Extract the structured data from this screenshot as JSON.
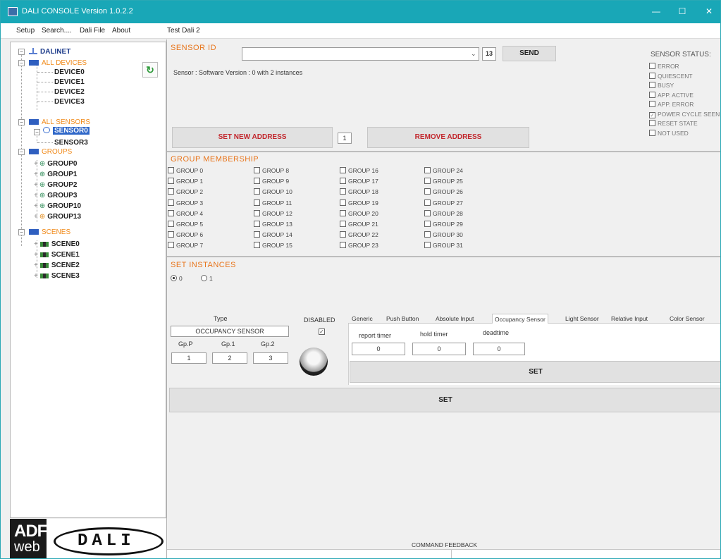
{
  "window": {
    "title": "DALI CONSOLE Version 1.0.2.2",
    "minimize": "—",
    "maximize": "☐",
    "close": "✕"
  },
  "menu": [
    "Setup",
    "Search....",
    "Dali File",
    "About",
    "Test Dali 2"
  ],
  "tree": {
    "root": "DALINET",
    "all_devices": "ALL DEVICES",
    "devices": [
      "DEVICE0",
      "DEVICE1",
      "DEVICE2",
      "DEVICE3"
    ],
    "all_sensors": "ALL SENSORS",
    "sensors": [
      "SENSOR0",
      "SENSOR3"
    ],
    "groups_label": "GROUPS",
    "groups": [
      "GROUP0",
      "GROUP1",
      "GROUP2",
      "GROUP3",
      "GROUP10",
      "GROUP13"
    ],
    "scenes_label": "SCENES",
    "scenes": [
      "SCENE0",
      "SCENE1",
      "SCENE2",
      "SCENE3"
    ],
    "refresh_icon": "refresh-icon"
  },
  "sensor_id": {
    "title": "SENSOR ID",
    "combo_value": "",
    "count": "13",
    "send": "SEND",
    "info": "Sensor :  Software Version : 0 with 2 instances"
  },
  "address": {
    "set_label": "SET NEW ADDRESS",
    "value": "1",
    "remove_label": "REMOVE  ADDRESS"
  },
  "sensor_status": {
    "title": "SENSOR STATUS:",
    "items": [
      {
        "label": "ERROR",
        "checked": false
      },
      {
        "label": "QUIESCENT",
        "checked": false
      },
      {
        "label": "BUSY",
        "checked": false
      },
      {
        "label": "APP. ACTIVE",
        "checked": false
      },
      {
        "label": "APP. ERROR",
        "checked": false
      },
      {
        "label": "POWER CYCLE SEEN",
        "checked": true
      },
      {
        "label": "RESET STATE",
        "checked": false
      },
      {
        "label": "NOT USED",
        "checked": false
      }
    ]
  },
  "group_membership": {
    "title": "GROUP MEMBERSHIP",
    "columns": [
      [
        "GROUP 0",
        "GROUP 1",
        "GROUP 2",
        "GROUP 3",
        "GROUP 4",
        "GROUP 5",
        "GROUP 6",
        "GROUP 7"
      ],
      [
        "GROUP 8",
        "GROUP 9",
        "GROUP 10",
        "GROUP 11",
        "GROUP 12",
        "GROUP 13",
        "GROUP 14",
        "GROUP 15"
      ],
      [
        "GROUP 16",
        "GROUP 17",
        "GROUP 18",
        "GROUP 19",
        "GROUP 20",
        "GROUP 21",
        "GROUP 22",
        "GROUP 23"
      ],
      [
        "GROUP 24",
        "GROUP 25",
        "GROUP 26",
        "GROUP 27",
        "GROUP 28",
        "GROUP 29",
        "GROUP 30",
        "GROUP 31"
      ]
    ]
  },
  "instances": {
    "title": "SET INSTANCES",
    "options": [
      "0",
      "1"
    ],
    "selected": "0"
  },
  "instance": {
    "type_label": "Type",
    "type_value": "OCCUPANCY SENSOR",
    "gp_labels": [
      "Gp.P",
      "Gp.1",
      "Gp.2"
    ],
    "gp_values": [
      "1",
      "2",
      "3"
    ],
    "disabled_label": "DISABLED",
    "disabled_checked": true,
    "tabs": [
      "Generic",
      "Push Button",
      "Absolute Input",
      "Occupancy Sensor",
      "Light Sensor",
      "Relative Input",
      "Color Sensor"
    ],
    "active_tab": "Occupancy Sensor",
    "fields": [
      {
        "label": "report timer",
        "value": "0"
      },
      {
        "label": "hold timer",
        "value": "0"
      },
      {
        "label": "deadtime",
        "value": "0"
      }
    ],
    "set_label": "SET"
  },
  "main_set": "SET",
  "command_feedback": "COMMAND FEEDBACK",
  "logo": {
    "adf": "ADF",
    "web": "web",
    "dali": "DALI"
  }
}
